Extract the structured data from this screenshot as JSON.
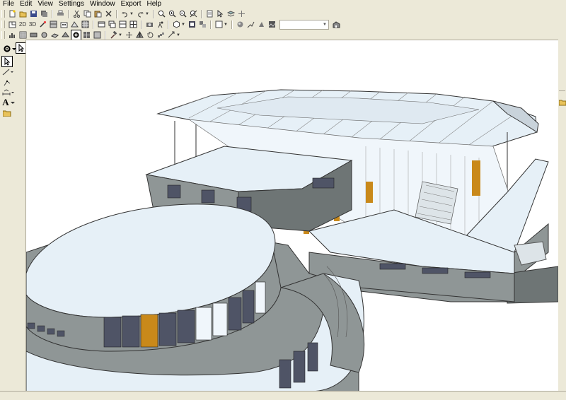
{
  "menu": {
    "items": [
      "File",
      "Edit",
      "View",
      "Settings",
      "Window",
      "Export",
      "Help"
    ]
  },
  "toolbar": {
    "view_2d_label": "2D",
    "view_3d_label": "3D"
  },
  "toolbox": {
    "text_tool_glyph": "A"
  },
  "colors": {
    "window_bg": "#ece9d8",
    "canvas_bg": "#ffffff",
    "roof": "#e6f0f7",
    "wall": "#8f9696",
    "wall_dark": "#6e7575",
    "glass": "#4f5466",
    "frame": "#c9891a",
    "outline": "#333333"
  }
}
